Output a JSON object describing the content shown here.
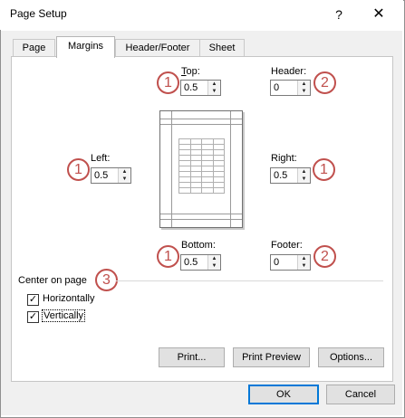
{
  "window": {
    "title": "Page Setup",
    "help": "?",
    "close": "✕"
  },
  "tabs": [
    {
      "label": "Page"
    },
    {
      "label": "Margins"
    },
    {
      "label": "Header/Footer"
    },
    {
      "label": "Sheet"
    }
  ],
  "margins": {
    "top": {
      "label": "Top:",
      "value": "0.5"
    },
    "header": {
      "label": "Header:",
      "value": "0"
    },
    "left": {
      "label": "Left:",
      "value": "0.5"
    },
    "right": {
      "label": "Right:",
      "value": "0.5"
    },
    "bottom": {
      "label": "Bottom:",
      "value": "0.5"
    },
    "footer": {
      "label": "Footer:",
      "value": "0"
    }
  },
  "annotations": {
    "one": "1",
    "two": "2",
    "three": "3"
  },
  "center": {
    "label": "Center on page",
    "horizontally": {
      "label": "Horizontally",
      "checked": true
    },
    "vertically": {
      "label": "Vertically",
      "checked": true
    }
  },
  "buttons": {
    "print": "Print...",
    "print_preview": "Print Preview",
    "options": "Options...",
    "ok": "OK",
    "cancel": "Cancel"
  },
  "colors": {
    "accent": "#0078d7",
    "annotation": "#c0504d"
  }
}
